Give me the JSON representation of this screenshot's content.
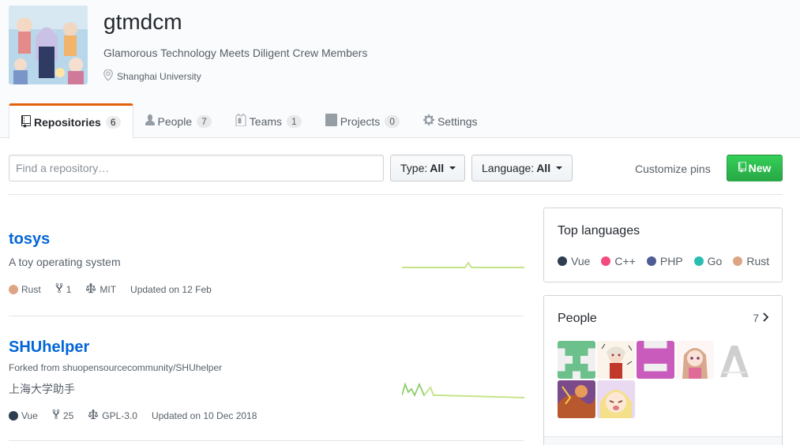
{
  "org": {
    "name": "gtmdcm",
    "description": "Glamorous Technology Meets Diligent Crew Members",
    "location": "Shanghai University"
  },
  "tabs": [
    {
      "label": "Repositories",
      "count": "6",
      "icon": "repo-icon"
    },
    {
      "label": "People",
      "count": "7",
      "icon": "person-icon"
    },
    {
      "label": "Teams",
      "count": "1",
      "icon": "jersey-icon"
    },
    {
      "label": "Projects",
      "count": "0",
      "icon": "project-icon"
    },
    {
      "label": "Settings",
      "icon": "gear-icon"
    }
  ],
  "filters": {
    "search_placeholder": "Find a repository…",
    "type_label": "Type:",
    "type_value": "All",
    "language_label": "Language:",
    "language_value": "All",
    "customize_pins": "Customize pins",
    "new_button": "New"
  },
  "repos": [
    {
      "name": "tosys",
      "description": "A toy operating system",
      "language": "Rust",
      "language_color": "#dea584",
      "forks": "1",
      "license": "MIT",
      "updated": "Updated on 12 Feb"
    },
    {
      "name": "SHUhelper",
      "forked_from": "Forked from shuopensourcecommunity/SHUhelper",
      "description": "上海大学助手",
      "language": "Vue",
      "language_color": "#2c3e50",
      "forks": "25",
      "license": "GPL-3.0",
      "updated": "Updated on 10 Dec 2018"
    }
  ],
  "top_languages": {
    "title": "Top languages",
    "items": [
      {
        "name": "Vue",
        "color": "#2c3e50"
      },
      {
        "name": "C++",
        "color": "#f34b7d"
      },
      {
        "name": "PHP",
        "color": "#4F5D95"
      },
      {
        "name": "Go",
        "color": "#29BEB0"
      },
      {
        "name": "Rust",
        "color": "#dea584"
      }
    ]
  },
  "people": {
    "title": "People",
    "count": "7"
  },
  "colors": {
    "link": "#0366d6",
    "active_tab": "#e36209",
    "new_button": "#28a745",
    "sparkline": "#c6e48b"
  }
}
